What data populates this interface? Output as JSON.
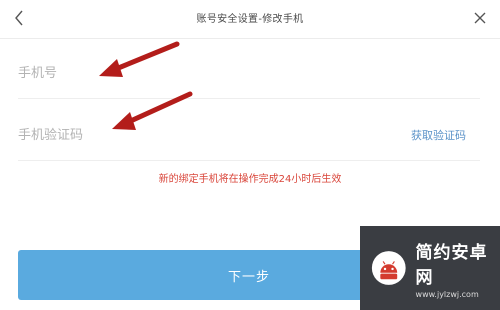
{
  "header": {
    "title": "账号安全设置-修改手机",
    "back_icon": "chevron-left-icon",
    "close_icon": "close-icon"
  },
  "form": {
    "phone_placeholder": "手机号",
    "code_placeholder": "手机验证码",
    "get_code_label": "获取验证码",
    "notice": "新的绑定手机将在操作完成24小时后生效",
    "next_label": "下一步"
  },
  "watermark": {
    "name": "简约安卓网",
    "url": "www.jylzwj.com"
  },
  "colors": {
    "accent": "#5aaadf",
    "link": "#5a92c8",
    "notice": "#d9453a",
    "arrow": "#b31d1a"
  }
}
